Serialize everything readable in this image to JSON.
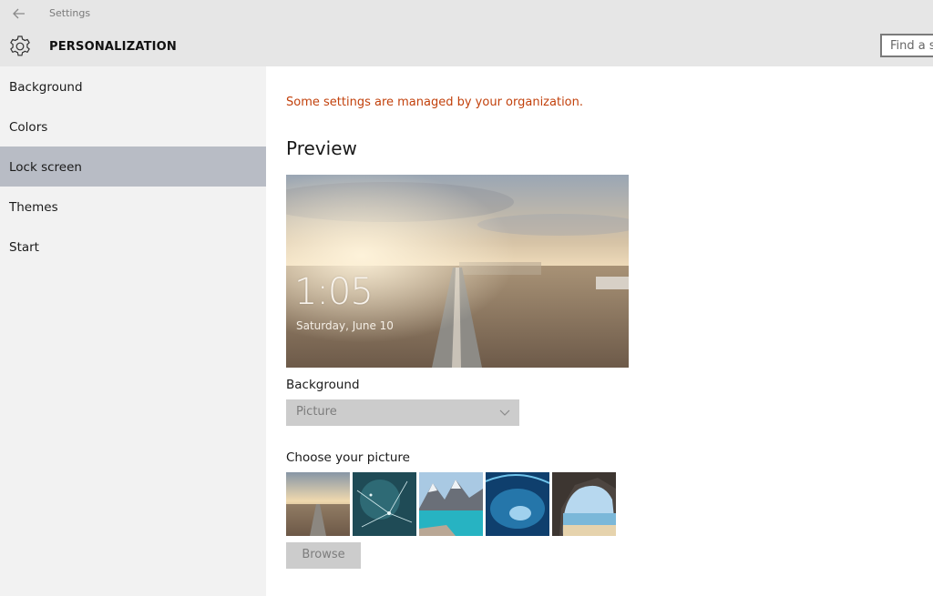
{
  "window": {
    "title": "Settings"
  },
  "header": {
    "section_title": "PERSONALIZATION",
    "search_placeholder": "Find a se"
  },
  "sidebar": {
    "items": [
      {
        "label": "Background"
      },
      {
        "label": "Colors"
      },
      {
        "label": "Lock screen",
        "active": true
      },
      {
        "label": "Themes"
      },
      {
        "label": "Start"
      }
    ]
  },
  "main": {
    "notice": "Some settings are managed by your organization.",
    "preview_title": "Preview",
    "preview": {
      "time": "1:05",
      "date": "Saturday, June 10"
    },
    "background_label": "Background",
    "background_value": "Picture",
    "choose_label": "Choose your picture",
    "browse_label": "Browse"
  },
  "colors": {
    "accent_notice": "#c2410c",
    "active_nav": "#b8bcc5"
  },
  "icons": [
    "back-arrow-icon",
    "gear-icon",
    "chevron-down-icon"
  ]
}
